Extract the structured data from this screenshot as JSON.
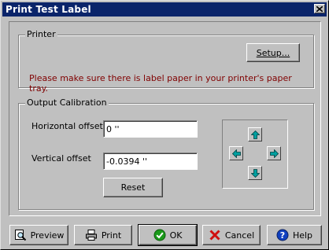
{
  "window": {
    "title": "Print Test Label"
  },
  "printer_group": {
    "label": "Printer",
    "setup_label": "Setup...",
    "warning": "Please make sure there is label paper in your printer's paper tray."
  },
  "calibration_group": {
    "label": "Output Calibration",
    "horizontal_label": "Horizontal offset",
    "horizontal_value": "0 ''",
    "vertical_label": "Vertical offset",
    "vertical_value": "-0.0394 ''",
    "reset_label": "Reset"
  },
  "buttons": {
    "preview": "Preview",
    "print": "Print",
    "ok": "OK",
    "cancel": "Cancel",
    "help": "Help"
  },
  "colors": {
    "title_bar": "#0a246a",
    "warning_text": "#800000",
    "arrow_fill": "#00a0a0",
    "ok_green": "#1a9a1a",
    "cancel_red": "#d01010",
    "help_blue": "#1040c0"
  },
  "icons": {
    "close": "close-icon",
    "arrows": [
      "arrow-up-icon",
      "arrow-left-icon",
      "arrow-right-icon",
      "arrow-down-icon"
    ],
    "preview": "magnifier-icon",
    "print": "printer-icon",
    "ok": "check-icon",
    "cancel": "x-icon",
    "help": "help-icon"
  }
}
